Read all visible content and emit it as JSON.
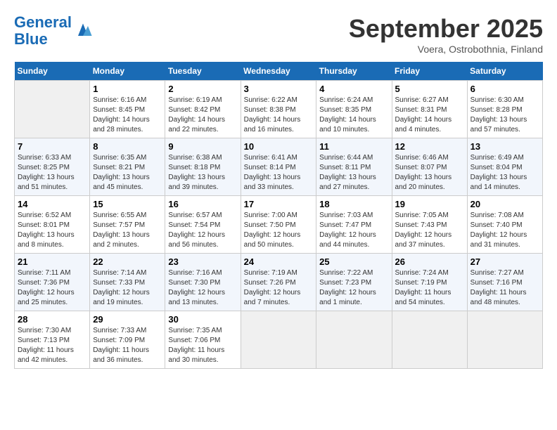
{
  "header": {
    "logo_line1": "General",
    "logo_line2": "Blue",
    "month": "September 2025",
    "location": "Voera, Ostrobothnia, Finland"
  },
  "weekdays": [
    "Sunday",
    "Monday",
    "Tuesday",
    "Wednesday",
    "Thursday",
    "Friday",
    "Saturday"
  ],
  "weeks": [
    [
      {
        "day": "",
        "info": ""
      },
      {
        "day": "1",
        "info": "Sunrise: 6:16 AM\nSunset: 8:45 PM\nDaylight: 14 hours\nand 28 minutes."
      },
      {
        "day": "2",
        "info": "Sunrise: 6:19 AM\nSunset: 8:42 PM\nDaylight: 14 hours\nand 22 minutes."
      },
      {
        "day": "3",
        "info": "Sunrise: 6:22 AM\nSunset: 8:38 PM\nDaylight: 14 hours\nand 16 minutes."
      },
      {
        "day": "4",
        "info": "Sunrise: 6:24 AM\nSunset: 8:35 PM\nDaylight: 14 hours\nand 10 minutes."
      },
      {
        "day": "5",
        "info": "Sunrise: 6:27 AM\nSunset: 8:31 PM\nDaylight: 14 hours\nand 4 minutes."
      },
      {
        "day": "6",
        "info": "Sunrise: 6:30 AM\nSunset: 8:28 PM\nDaylight: 13 hours\nand 57 minutes."
      }
    ],
    [
      {
        "day": "7",
        "info": "Sunrise: 6:33 AM\nSunset: 8:25 PM\nDaylight: 13 hours\nand 51 minutes."
      },
      {
        "day": "8",
        "info": "Sunrise: 6:35 AM\nSunset: 8:21 PM\nDaylight: 13 hours\nand 45 minutes."
      },
      {
        "day": "9",
        "info": "Sunrise: 6:38 AM\nSunset: 8:18 PM\nDaylight: 13 hours\nand 39 minutes."
      },
      {
        "day": "10",
        "info": "Sunrise: 6:41 AM\nSunset: 8:14 PM\nDaylight: 13 hours\nand 33 minutes."
      },
      {
        "day": "11",
        "info": "Sunrise: 6:44 AM\nSunset: 8:11 PM\nDaylight: 13 hours\nand 27 minutes."
      },
      {
        "day": "12",
        "info": "Sunrise: 6:46 AM\nSunset: 8:07 PM\nDaylight: 13 hours\nand 20 minutes."
      },
      {
        "day": "13",
        "info": "Sunrise: 6:49 AM\nSunset: 8:04 PM\nDaylight: 13 hours\nand 14 minutes."
      }
    ],
    [
      {
        "day": "14",
        "info": "Sunrise: 6:52 AM\nSunset: 8:01 PM\nDaylight: 13 hours\nand 8 minutes."
      },
      {
        "day": "15",
        "info": "Sunrise: 6:55 AM\nSunset: 7:57 PM\nDaylight: 13 hours\nand 2 minutes."
      },
      {
        "day": "16",
        "info": "Sunrise: 6:57 AM\nSunset: 7:54 PM\nDaylight: 12 hours\nand 56 minutes."
      },
      {
        "day": "17",
        "info": "Sunrise: 7:00 AM\nSunset: 7:50 PM\nDaylight: 12 hours\nand 50 minutes."
      },
      {
        "day": "18",
        "info": "Sunrise: 7:03 AM\nSunset: 7:47 PM\nDaylight: 12 hours\nand 44 minutes."
      },
      {
        "day": "19",
        "info": "Sunrise: 7:05 AM\nSunset: 7:43 PM\nDaylight: 12 hours\nand 37 minutes."
      },
      {
        "day": "20",
        "info": "Sunrise: 7:08 AM\nSunset: 7:40 PM\nDaylight: 12 hours\nand 31 minutes."
      }
    ],
    [
      {
        "day": "21",
        "info": "Sunrise: 7:11 AM\nSunset: 7:36 PM\nDaylight: 12 hours\nand 25 minutes."
      },
      {
        "day": "22",
        "info": "Sunrise: 7:14 AM\nSunset: 7:33 PM\nDaylight: 12 hours\nand 19 minutes."
      },
      {
        "day": "23",
        "info": "Sunrise: 7:16 AM\nSunset: 7:30 PM\nDaylight: 12 hours\nand 13 minutes."
      },
      {
        "day": "24",
        "info": "Sunrise: 7:19 AM\nSunset: 7:26 PM\nDaylight: 12 hours\nand 7 minutes."
      },
      {
        "day": "25",
        "info": "Sunrise: 7:22 AM\nSunset: 7:23 PM\nDaylight: 12 hours\nand 1 minute."
      },
      {
        "day": "26",
        "info": "Sunrise: 7:24 AM\nSunset: 7:19 PM\nDaylight: 11 hours\nand 54 minutes."
      },
      {
        "day": "27",
        "info": "Sunrise: 7:27 AM\nSunset: 7:16 PM\nDaylight: 11 hours\nand 48 minutes."
      }
    ],
    [
      {
        "day": "28",
        "info": "Sunrise: 7:30 AM\nSunset: 7:13 PM\nDaylight: 11 hours\nand 42 minutes."
      },
      {
        "day": "29",
        "info": "Sunrise: 7:33 AM\nSunset: 7:09 PM\nDaylight: 11 hours\nand 36 minutes."
      },
      {
        "day": "30",
        "info": "Sunrise: 7:35 AM\nSunset: 7:06 PM\nDaylight: 11 hours\nand 30 minutes."
      },
      {
        "day": "",
        "info": ""
      },
      {
        "day": "",
        "info": ""
      },
      {
        "day": "",
        "info": ""
      },
      {
        "day": "",
        "info": ""
      }
    ]
  ]
}
